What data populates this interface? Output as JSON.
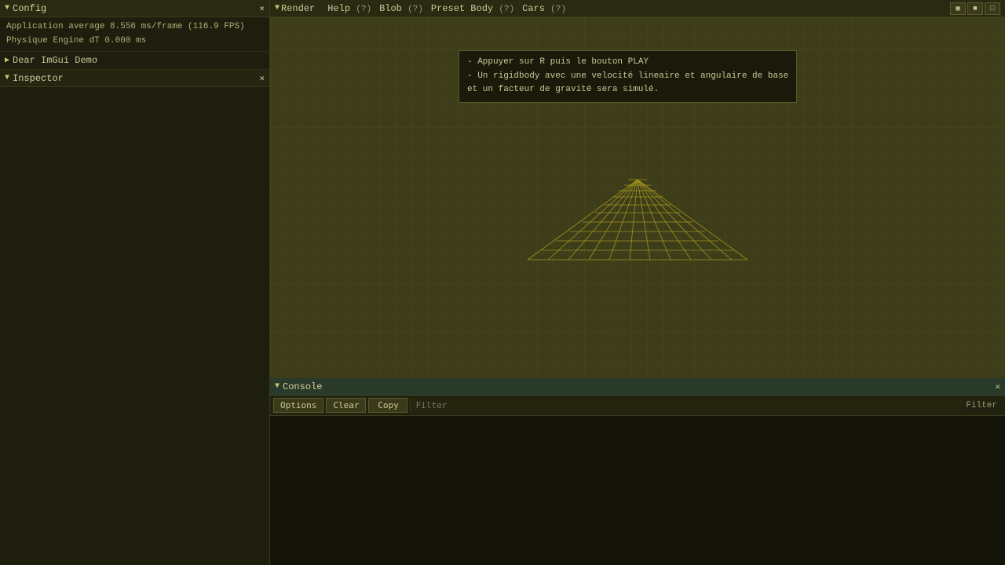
{
  "left_panel": {
    "config_title": "Config",
    "close_label": "×",
    "stats": {
      "line1": "Application average 8.556 ms/frame (116.9 FPS)",
      "line2": "Physique Engine dT 0.000 ms"
    },
    "dear_imgui": {
      "label": "Dear ImGui Demo",
      "arrow": "▶"
    },
    "inspector": {
      "title": "Inspector",
      "arrow": "▼",
      "close_label": "×"
    }
  },
  "render_panel": {
    "title": "Render",
    "arrow": "▼",
    "menu_items": [
      {
        "label": "Help",
        "hint": "(?)"
      },
      {
        "label": "Blob",
        "hint": "(?)"
      },
      {
        "label": "Preset Body",
        "hint": "(?)"
      },
      {
        "label": "Cars",
        "hint": "(?)"
      }
    ],
    "btn1": "▣",
    "btn2": "■",
    "btn3": "□"
  },
  "tooltip": {
    "line1": "- Appuyer sur R puis le bouton PLAY",
    "line2": "- Un rigidbody avec une velocité lineaire et angulaire de base",
    "line3": "et un facteur de gravité sera simulé."
  },
  "console_panel": {
    "title": "Console",
    "arrow": "▼",
    "close_label": "×",
    "buttons": {
      "options": "Options",
      "clear": "Clear",
      "copy": "Copy"
    },
    "filter_label": "Filter"
  }
}
